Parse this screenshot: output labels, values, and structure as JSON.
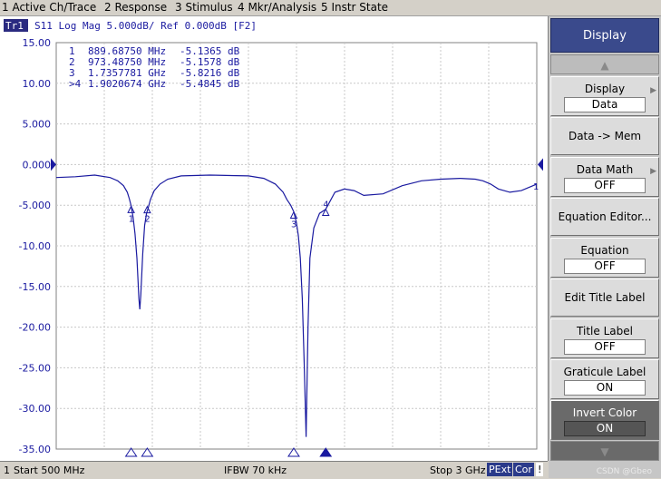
{
  "menu": {
    "items": [
      "1 Active Ch/Trace",
      "2 Response",
      "3 Stimulus",
      "4 Mkr/Analysis",
      "5 Instr State"
    ]
  },
  "trace": {
    "tag": "Tr1",
    "header": "S11 Log Mag 5.000dB/ Ref 0.000dB [F2]",
    "color": "#1a1aa0"
  },
  "markers": [
    {
      "label": "1",
      "prefix": " ",
      "freq": "889.68750 MHz",
      "value": "-5.1365 dB"
    },
    {
      "label": "2",
      "prefix": " ",
      "freq": "973.48750 MHz",
      "value": "-5.1578 dB"
    },
    {
      "label": "3",
      "prefix": " ",
      "freq": "1.7357781 GHz",
      "value": "-5.8216 dB"
    },
    {
      "label": "4",
      "prefix": ">",
      "freq": "1.9020674 GHz",
      "value": "-5.4845 dB"
    }
  ],
  "status": {
    "channel": "1",
    "start": "Start 500 MHz",
    "ifbw": "IFBW 70 kHz",
    "stop": "Stop 3 GHz",
    "badge_pext": "PExt",
    "badge_cor": "Cor",
    "badge_excl": "!"
  },
  "softkeys": {
    "title": "Display",
    "display_label": "Display",
    "display_value": "Data",
    "data_mem": "Data -> Mem",
    "data_math_label": "Data Math",
    "data_math_value": "OFF",
    "equation_editor": "Equation Editor...",
    "equation_label": "Equation",
    "equation_value": "OFF",
    "edit_title": "Edit Title Label",
    "title_label": "Title Label",
    "title_value": "OFF",
    "graticule_label": "Graticule Label",
    "graticule_value": "ON",
    "invert_label": "Invert Color",
    "invert_value": "ON"
  },
  "watermark": "CSDN @Gbeo",
  "chart_data": {
    "type": "line",
    "y_ticks": [
      "15.00",
      "10.00",
      "5.000",
      "0.000",
      "-5.000",
      "-10.00",
      "-15.00",
      "-20.00",
      "-25.00",
      "-30.00",
      "-35.00"
    ],
    "ylim": [
      -35,
      15
    ],
    "xlim_mhz": [
      500,
      3000
    ],
    "reference_value": 0,
    "series": [
      {
        "x": [
          500,
          600,
          700,
          780,
          820,
          850,
          870,
          880,
          890,
          900,
          910,
          920,
          925,
          930,
          935,
          940,
          950,
          960,
          970,
          980,
          990,
          1010,
          1040,
          1080,
          1150,
          1300,
          1500,
          1580,
          1640,
          1680,
          1700,
          1720,
          1736,
          1750,
          1760,
          1770,
          1780,
          1790,
          1800,
          1810,
          1820,
          1840,
          1870,
          1902,
          1950,
          2000,
          2050,
          2100,
          2200,
          2300,
          2400,
          2500,
          2600,
          2680,
          2720,
          2760,
          2800,
          2860,
          2920,
          3000
        ],
        "values": [
          -1.6,
          -1.5,
          -1.3,
          -1.6,
          -2.0,
          -2.6,
          -3.4,
          -4.2,
          -5.1,
          -6.5,
          -8.5,
          -11.5,
          -14.0,
          -16.5,
          -17.8,
          -16.0,
          -11.0,
          -7.5,
          -6.0,
          -5.2,
          -4.3,
          -3.2,
          -2.4,
          -1.8,
          -1.4,
          -1.3,
          -1.4,
          -1.7,
          -2.4,
          -3.4,
          -4.3,
          -5.0,
          -5.8,
          -7.2,
          -8.8,
          -11.5,
          -16.5,
          -24.5,
          -33.5,
          -20.0,
          -11.5,
          -7.8,
          -6.0,
          -5.5,
          -3.4,
          -3.0,
          -3.2,
          -3.8,
          -3.6,
          -2.6,
          -2.0,
          -1.8,
          -1.7,
          -1.8,
          -2.0,
          -2.4,
          -3.0,
          -3.4,
          -3.2,
          -2.4
        ]
      }
    ],
    "marker_points": [
      {
        "label": "1",
        "x": 889.6875,
        "y": -5.1365
      },
      {
        "label": "2",
        "x": 973.4875,
        "y": -5.1578
      },
      {
        "label": "3",
        "x": 1735.7781,
        "y": -5.8216
      },
      {
        "label": "4",
        "x": 1902.0674,
        "y": -5.4845
      }
    ],
    "grid": true
  }
}
